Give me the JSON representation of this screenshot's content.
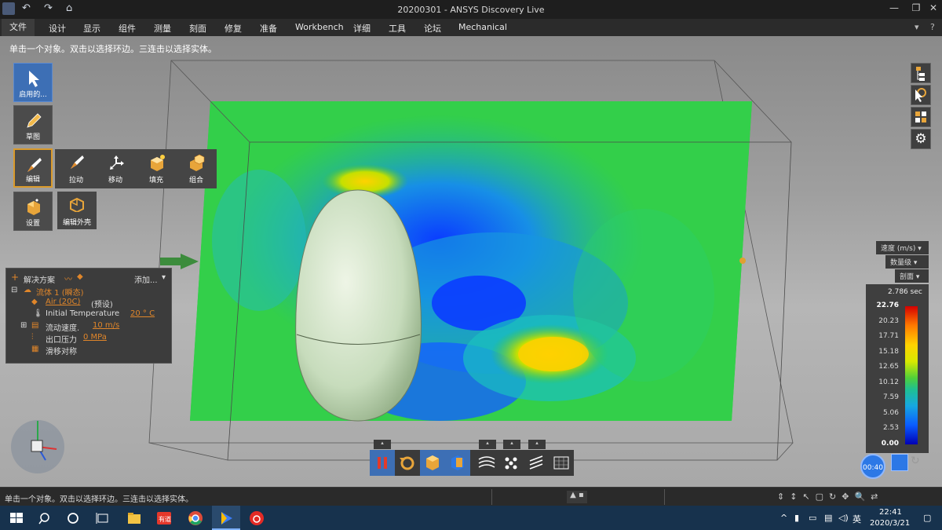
{
  "window": {
    "title": "20200301 - ANSYS Discovery Live",
    "quick_access": {
      "undo": "↶",
      "redo": "↷",
      "home": "⌂"
    },
    "controls": {
      "restore": "❐",
      "close": "✕",
      "minimize": "—"
    }
  },
  "ribbon": {
    "tabs": [
      "文件",
      "设计",
      "显示",
      "组件",
      "测量",
      "刻面",
      "修复",
      "准备",
      "Workbench",
      "详细",
      "工具",
      "论坛",
      "Mechanical"
    ]
  },
  "viewport": {
    "hint": "单击一个对象。双击以选择环边。三连击以选择实体。"
  },
  "toolbox": {
    "main": [
      {
        "label": "启用的...",
        "icon": "cursor-icon"
      },
      {
        "label": "草图",
        "icon": "pencil-icon"
      },
      {
        "label": "编辑",
        "icon": "edit-icon"
      },
      {
        "label": "设置",
        "icon": "setup-icon"
      }
    ],
    "sub": [
      {
        "label": "拉动",
        "icon": "pull-icon"
      },
      {
        "label": "移动",
        "icon": "move-icon"
      },
      {
        "label": "填充",
        "icon": "fill-icon"
      },
      {
        "label": "组合",
        "icon": "combine-icon"
      }
    ],
    "sub2": {
      "label": "编辑外壳",
      "icon": "shell-icon"
    }
  },
  "tree": {
    "header": {
      "title": "解决方案",
      "add": "添加..."
    },
    "fluid": {
      "name": "流体 1 (瞬态)"
    },
    "material": {
      "name": "Air (20C)",
      "suffix": "(预设)"
    },
    "temperature": {
      "label": "Initial Temperature",
      "value": "20 ° C"
    },
    "velocity": {
      "label": "流动速度.",
      "value": "10 m/s"
    },
    "outlet": {
      "label": "出口压力",
      "value": "0 MPa"
    },
    "symmetry": {
      "label": "滑移对称"
    }
  },
  "results": {
    "quantity": "速度 (m/s)",
    "display": "数量级",
    "mode": "剖面",
    "time": "2.786 sec",
    "max": "22.76",
    "ticks": [
      "20.23",
      "17.71",
      "15.18",
      "12.65",
      "10.12",
      "7.59",
      "5.06",
      "2.53"
    ],
    "min": "0.00",
    "timer": "00:40",
    "colors": {
      "max": "#d40000",
      "mid": "#4fcf3a",
      "min": "#0000b4"
    }
  },
  "status": {
    "message": "单击一个对象。双击以选择环边。三连击以选择实体。"
  },
  "taskbar": {
    "apps": [
      "windows-icon",
      "search-icon",
      "cortana-icon",
      "task-view-icon",
      "file-explorer-icon",
      "youdao-icon",
      "chrome-icon",
      "media-icon",
      "netease-music-icon"
    ],
    "tray": {
      "ime": "英",
      "time": "22:41",
      "date": "2020/3/21"
    }
  },
  "colors": {
    "accent": "#3d6fb5",
    "link": "#e0862a",
    "taskbar": "#17324d"
  }
}
